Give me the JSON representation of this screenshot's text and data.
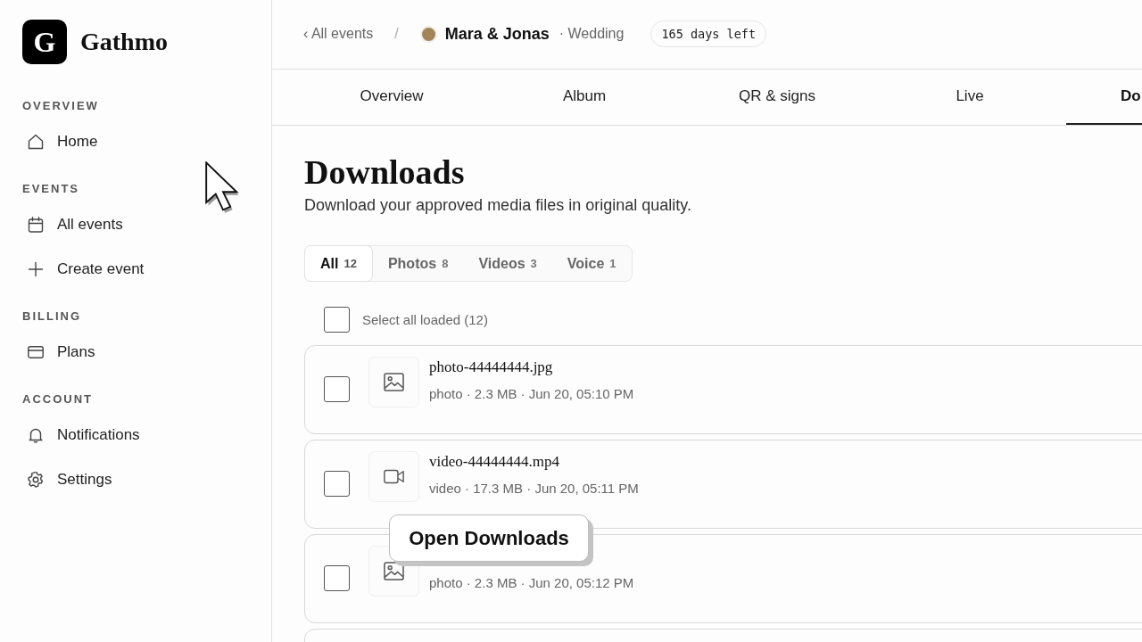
{
  "sidebar": {
    "logo_letter": "G",
    "brand": "Gathmo",
    "sections": [
      {
        "title": "OVERVIEW",
        "items": [
          {
            "label": "Home"
          }
        ]
      },
      {
        "title": "EVENTS",
        "items": [
          {
            "label": "All events"
          },
          {
            "label": "Create event"
          }
        ]
      },
      {
        "title": "BILLING",
        "items": [
          {
            "label": "Plans"
          }
        ]
      },
      {
        "title": "ACCOUNT",
        "items": [
          {
            "label": "Notifications"
          },
          {
            "label": "Settings"
          }
        ]
      }
    ]
  },
  "header": {
    "back_link": "‹ All events",
    "separator": "/",
    "event_name": "Mara & Jonas",
    "event_type": "· Wedding",
    "badge": "165 days left"
  },
  "tabs": [
    {
      "label": "Overview",
      "selected": false
    },
    {
      "label": "Album",
      "selected": false
    },
    {
      "label": "QR & signs",
      "selected": false
    },
    {
      "label": "Live",
      "selected": false
    },
    {
      "label": "Do",
      "selected": true
    }
  ],
  "page": {
    "title": "Downloads",
    "subtitle": "Download your approved media files in original quality."
  },
  "filters": [
    {
      "label": "All",
      "count": "12",
      "selected": true
    },
    {
      "label": "Photos",
      "count": "8",
      "selected": false
    },
    {
      "label": "Videos",
      "count": "3",
      "selected": false
    },
    {
      "label": "Voice",
      "count": "1",
      "selected": false
    }
  ],
  "select_all": {
    "label": "Select all loaded (12)",
    "checked": false
  },
  "files": [
    {
      "kind": "photo",
      "name": "photo-44444444.jpg",
      "meta": "photo · 2.3 MB · Jun 20, 05:10 PM",
      "checked": false
    },
    {
      "kind": "video",
      "name": "video-44444444.mp4",
      "meta": "video · 17.3 MB · Jun 20, 05:11 PM",
      "checked": false
    },
    {
      "kind": "photo",
      "meta": "photo · 2.3 MB · Jun 20, 05:12 PM",
      "checked": false
    }
  ],
  "tooltip": "Open Downloads"
}
